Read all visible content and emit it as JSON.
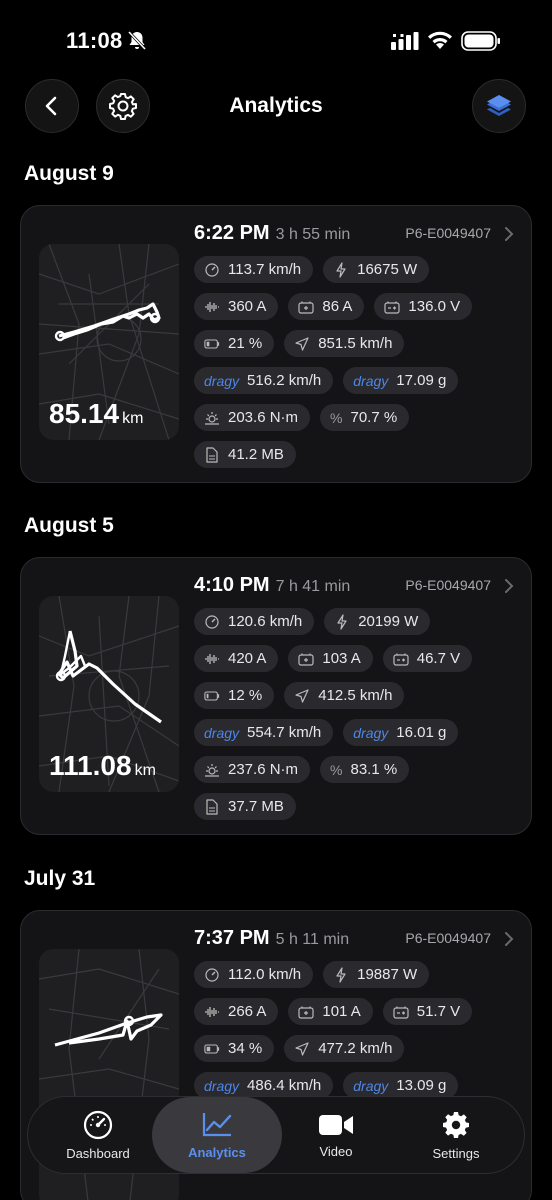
{
  "status": {
    "time": "11:08"
  },
  "header": {
    "title": "Analytics"
  },
  "rides": [
    {
      "date": "August 9",
      "time": "6:22 PM",
      "duration": "3 h 55 min",
      "device_id": "P6-E0049407",
      "distance": "85.14",
      "distance_unit": "km",
      "max_speed": "113.7 km/h",
      "power": "16675 W",
      "phase_current": "360 A",
      "battery_current": "86 A",
      "voltage": "136.0 V",
      "battery_level": "21 %",
      "gps_speed": "851.5 km/h",
      "dragy_speed": "516.2 km/h",
      "dragy_g": "17.09 g",
      "torque": "203.6 N·m",
      "efficiency": "70.7 %",
      "file_size": "41.2 MB"
    },
    {
      "date": "August 5",
      "time": "4:10 PM",
      "duration": "7 h 41 min",
      "device_id": "P6-E0049407",
      "distance": "111.08",
      "distance_unit": "km",
      "max_speed": "120.6 km/h",
      "power": "20199 W",
      "phase_current": "420 A",
      "battery_current": "103 A",
      "voltage": "46.7 V",
      "battery_level": "12 %",
      "gps_speed": "412.5 km/h",
      "dragy_speed": "554.7 km/h",
      "dragy_g": "16.01 g",
      "torque": "237.6 N·m",
      "efficiency": "83.1 %",
      "file_size": "37.7 MB"
    },
    {
      "date": "July 31",
      "time": "7:37 PM",
      "duration": "5 h 11 min",
      "device_id": "P6-E0049407",
      "max_speed": "112.0 km/h",
      "power": "19887 W",
      "phase_current": "266 A",
      "battery_current": "101 A",
      "voltage": "51.7 V",
      "battery_level": "34 %",
      "gps_speed": "477.2 km/h",
      "dragy_speed": "486.4 km/h",
      "dragy_g": "13.09 g"
    }
  ],
  "dragy_label": "dragy",
  "pct_symbol": "%",
  "tabs": [
    {
      "label": "Dashboard",
      "icon": "speedometer-icon"
    },
    {
      "label": "Analytics",
      "icon": "chart-line-icon",
      "active": true
    },
    {
      "label": "Video",
      "icon": "video-camera-icon"
    },
    {
      "label": "Settings",
      "icon": "gear-icon"
    }
  ],
  "colors": {
    "background": "#000000",
    "card": "#141416",
    "chip": "#2a2a2e",
    "accent": "#4f86e8"
  }
}
